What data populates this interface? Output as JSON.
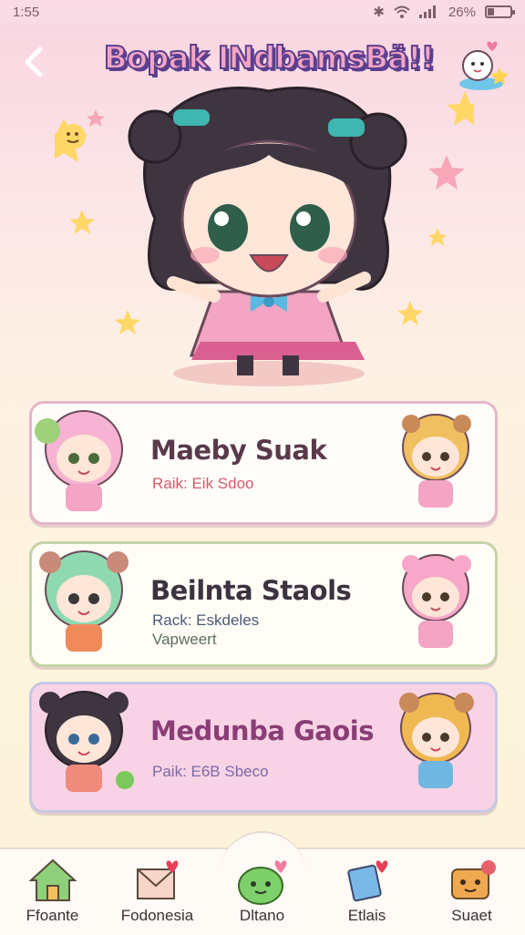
{
  "status_bar": {
    "time": "1:55",
    "battery": "26%",
    "battery_level": 0.26
  },
  "header": {
    "title": "Bopak INdbamsBä!!",
    "back_icon": "chevron-left-icon",
    "mascot_icon": "mascot-icon"
  },
  "cards": [
    {
      "title": "Maeby Suak",
      "subtitle": "Raik: Eik Sdoo",
      "subtitle2": ""
    },
    {
      "title": "Beilnta Staols",
      "subtitle": "Rack: Eskdeles",
      "subtitle2": "Vapweert"
    },
    {
      "title": "Medunba Gaois",
      "subtitle": "Paik: E6B Sbeco",
      "subtitle2": ""
    }
  ],
  "nav": [
    {
      "label": "Ffoante",
      "icon": "home-icon"
    },
    {
      "label": "Fodonesia",
      "icon": "envelope-heart-icon"
    },
    {
      "label": "Dltano",
      "icon": "slime-icon"
    },
    {
      "label": "Etlais",
      "icon": "card-heart-icon"
    },
    {
      "label": "Suaet",
      "icon": "box-heart-icon"
    }
  ],
  "colors": {
    "accent_pink": "#f3a5c3",
    "title_outline": "#5b3f8f",
    "card_3_bg": "#f8d3e5"
  }
}
